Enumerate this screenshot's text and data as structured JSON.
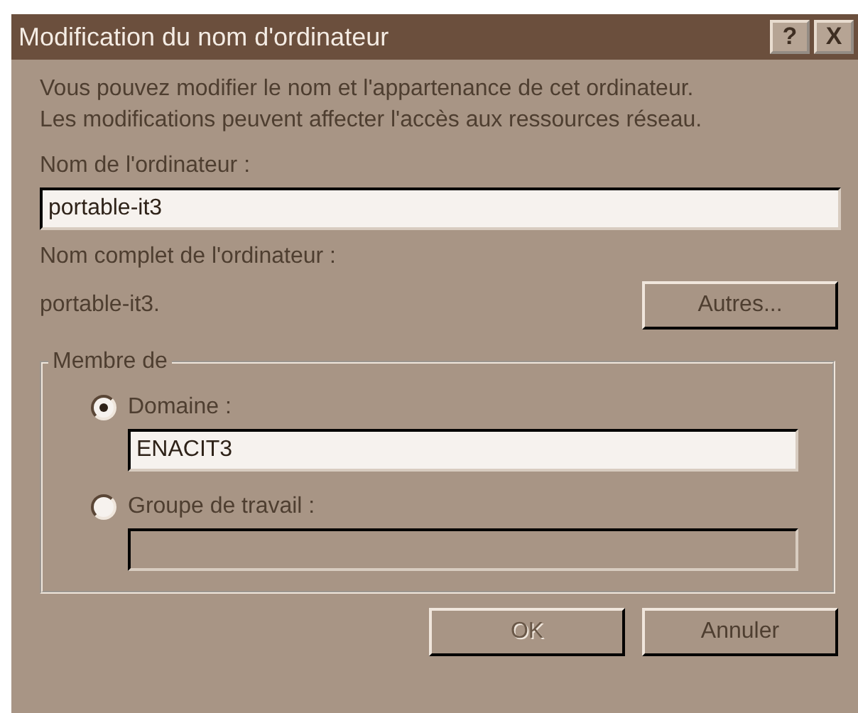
{
  "window": {
    "title": "Modification du nom d'ordinateur",
    "title_buttons": [
      "?",
      "X"
    ]
  },
  "description": "Vous pouvez modifier le nom et l'appartenance de cet ordinateur. Les modifications peuvent affecter l'accès aux ressources réseau.",
  "computer_name": {
    "label": "Nom de l'ordinateur :",
    "value": "portable-it3"
  },
  "full_name": {
    "label": "Nom complet de l'ordinateur :",
    "value": "portable-it3."
  },
  "more_button": {
    "label": "Autres..."
  },
  "member_of": {
    "legend": "Membre de",
    "options": [
      {
        "label": "Domaine :",
        "selected": true,
        "disabled": false,
        "value": "ENACIT3"
      },
      {
        "label": "Groupe de travail :",
        "selected": false,
        "disabled": true
      }
    ]
  },
  "buttons": [
    {
      "label": "OK",
      "disabled": true
    },
    {
      "label": "Annuler",
      "disabled": false
    }
  ]
}
